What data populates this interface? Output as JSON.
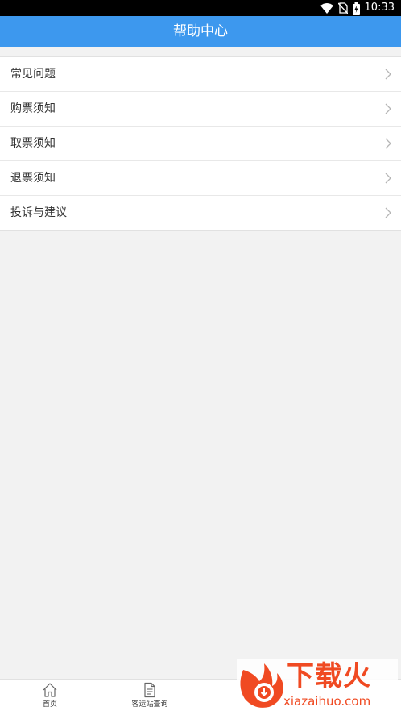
{
  "status_bar": {
    "time": "10:33",
    "icons": [
      "wifi-icon",
      "no-sim-icon",
      "battery-charging-icon"
    ]
  },
  "header": {
    "title": "帮助中心"
  },
  "menu": {
    "items": [
      {
        "label": "常见问题"
      },
      {
        "label": "购票须知"
      },
      {
        "label": "取票须知"
      },
      {
        "label": "退票须知"
      },
      {
        "label": "投诉与建议"
      }
    ]
  },
  "bottom_nav": {
    "items": [
      {
        "label": "首页",
        "icon": "home-icon"
      },
      {
        "label": "客运站查询",
        "icon": "document-icon"
      }
    ]
  },
  "watermark": {
    "brand": "下载火",
    "url": "xiazaihuo.com"
  },
  "colors": {
    "accent": "#3d98ee",
    "background": "#f2f2f2",
    "watermark": "#f04a22"
  }
}
